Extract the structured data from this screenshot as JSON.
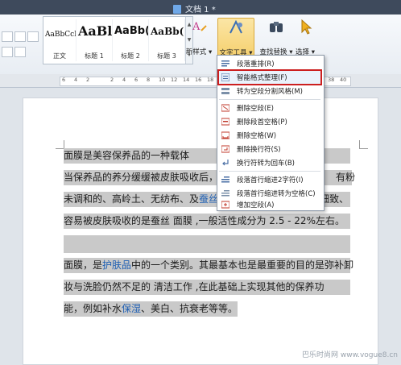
{
  "window": {
    "title": "文档 1 *"
  },
  "ribbon": {
    "styles": [
      {
        "sample": "AaBbCcDd",
        "label": "正文"
      },
      {
        "sample": "AaBl",
        "label": "标题 1"
      },
      {
        "sample": "AaBb(",
        "label": "标题 2"
      },
      {
        "sample": "AaBb(",
        "label": "标题 3"
      }
    ],
    "new_style_label": "新样式 ▾",
    "text_tools_label": "文字工具 ▾",
    "find_replace_label": "查找替换 ▾",
    "select_label": "选择 ▾"
  },
  "ruler": {
    "ticks": [
      "6",
      "4",
      "2",
      "",
      "2",
      "4",
      "6",
      "8",
      "10",
      "12",
      "14",
      "16",
      "18",
      "20",
      "22",
      "24",
      "26",
      "28",
      "30",
      "32",
      "34",
      "36",
      "38",
      "40"
    ]
  },
  "menu": {
    "items": [
      {
        "label": "段落重排(R)",
        "icon": "paragraph-rearrange-icon"
      },
      {
        "label": "智能格式整理(F)",
        "icon": "smart-format-icon",
        "highlight": true
      },
      {
        "label": "转为空段分割风格(M)",
        "icon": "split-style-icon"
      },
      {
        "label": "删除空段(E)",
        "icon": "delete-empty-paragraph-icon"
      },
      {
        "label": "删除段首空格(P)",
        "icon": "delete-leading-space-icon"
      },
      {
        "label": "删除空格(W)",
        "icon": "delete-space-icon"
      },
      {
        "label": "删除换行符(S)",
        "icon": "delete-linebreak-icon"
      },
      {
        "label": "换行符转为回车(B)",
        "icon": "linebreak-to-enter-icon"
      },
      {
        "label": "段落首行缩进2字符(I)",
        "icon": "indent-icon"
      },
      {
        "label": "段落首行缩进转为空格(C)",
        "icon": "indent-to-space-icon"
      },
      {
        "label": "增加空段(A)",
        "icon": "add-empty-paragraph-icon"
      }
    ]
  },
  "document": {
    "lines": [
      {
        "a": "        面膜是美容保养品的一种载体",
        "b": "",
        "c": "",
        "tail": "钟，",
        "tail_at": 305
      },
      {
        "a": "当保养品的养分缓缓被皮肤吸收后，眼",
        "b": "",
        "c": "",
        "tail": "有粉",
        "tail_at": 338
      },
      {
        "a": "未调和的、高岭土、无纺布、及",
        "b": "蚕丝",
        "c": "面",
        "tail": "细致、",
        "tail_at": 318
      },
      {
        "a": "容易被皮肤吸收的是蚕丝        面膜 ,一般活性成分为 2.5 - 22%左右。",
        "b": "",
        "c": "",
        "tail": "",
        "tail_at": 0
      },
      {
        "a": "面膜，是",
        "b": "护肤品",
        "c": "中的一个类别。其最基本也是最重要的目的是弥补卸",
        "tail": "",
        "tail_at": 0
      },
      {
        "a": "妆与洗脸仍然不足的          清洁工作 ,在此基础上实现其他的保养功",
        "b": "",
        "c": "",
        "tail": "",
        "tail_at": 0
      },
      {
        "a": "能，例如补水",
        "b": "保湿",
        "c": "、美白、抗衰老等等。",
        "tail": "",
        "tail_at": 0
      }
    ]
  },
  "watermark": "巴乐时尚网 www.vogue8.cn"
}
